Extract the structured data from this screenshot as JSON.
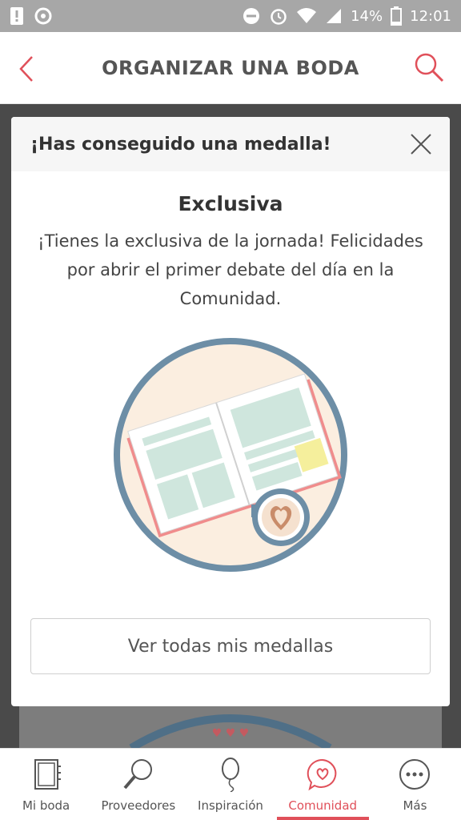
{
  "status_bar": {
    "battery_percent": "14%",
    "time": "12:01"
  },
  "header": {
    "title": "ORGANIZAR UNA BODA",
    "back_icon": "chevron-left-icon",
    "search_icon": "search-icon",
    "accent": "#e0505a"
  },
  "modal": {
    "header_title": "¡Has conseguido una medalla!",
    "close_icon": "close-icon",
    "medal_name": "Exclusiva",
    "medal_description": "¡Tienes la exclusiva de la jornada! Felicidades por abrir el primer debate del día en la Comunidad.",
    "illustration_icon": "newspaper-coffee-illustration",
    "button_label": "Ver todas mis medallas"
  },
  "bottom_nav": {
    "items": [
      {
        "label": "Mi boda",
        "icon": "notebook-icon",
        "active": false
      },
      {
        "label": "Proveedores",
        "icon": "magnifier-icon",
        "active": false
      },
      {
        "label": "Inspiración",
        "icon": "balloon-icon",
        "active": false
      },
      {
        "label": "Comunidad",
        "icon": "chat-heart-icon",
        "active": true
      },
      {
        "label": "Más",
        "icon": "more-icon",
        "active": false
      }
    ]
  }
}
